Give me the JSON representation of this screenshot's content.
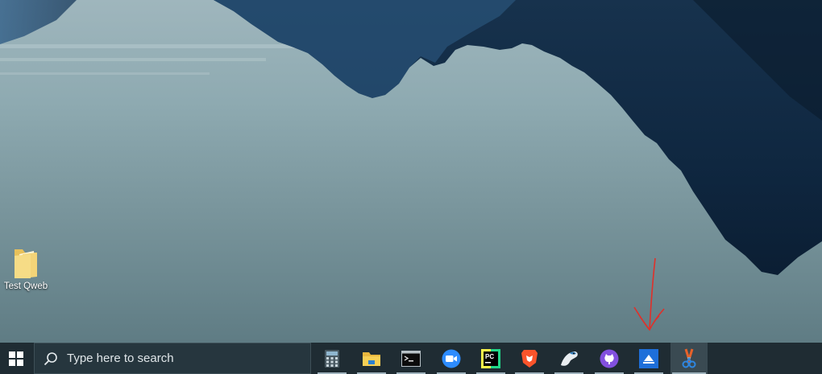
{
  "desktop": {
    "icons": [
      {
        "label": "Test Qweb",
        "icon": "folder-icon"
      }
    ]
  },
  "taskbar": {
    "start_icon": "windows-start-icon",
    "search": {
      "placeholder": "Type here to search",
      "icon": "search-icon"
    },
    "apps": [
      {
        "name": "calculator",
        "icon": "calculator-icon",
        "running": true
      },
      {
        "name": "file-explorer",
        "icon": "folder-icon",
        "running": true
      },
      {
        "name": "terminal",
        "icon": "terminal-icon",
        "running": true
      },
      {
        "name": "zoom",
        "icon": "video-camera-icon",
        "running": true
      },
      {
        "name": "pycharm",
        "icon": "pycharm-icon",
        "running": true
      },
      {
        "name": "brave",
        "icon": "lion-shield-icon",
        "running": true
      },
      {
        "name": "bird-app",
        "icon": "bird-icon",
        "running": true
      },
      {
        "name": "github-desktop",
        "icon": "github-icon",
        "running": true
      },
      {
        "name": "scanner",
        "icon": "scanner-icon",
        "running": true
      },
      {
        "name": "snipping-tool",
        "icon": "scissors-icon",
        "running": true,
        "active": true
      }
    ]
  },
  "colors": {
    "taskbar": "#1f2c33",
    "search_bg": "#26363e",
    "annotation": "#e0302a"
  }
}
